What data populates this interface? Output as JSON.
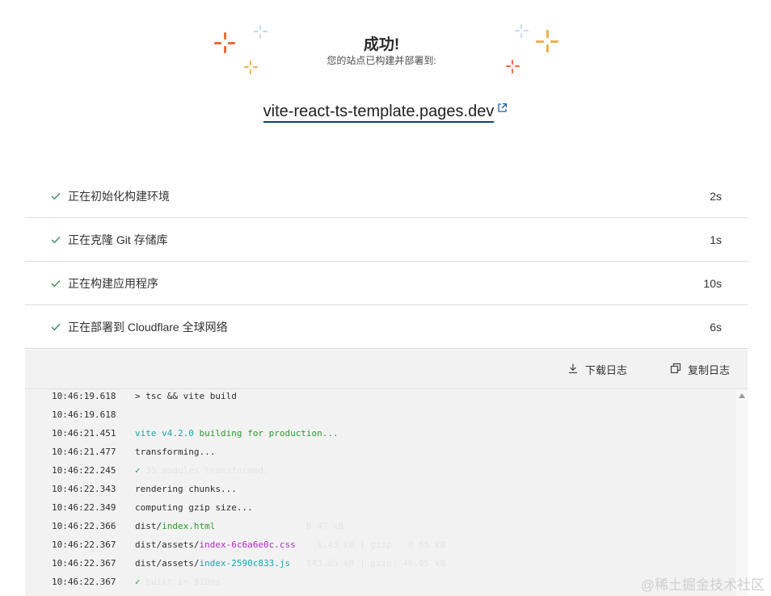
{
  "header": {
    "title": "成功!",
    "subtitle": "您的站点已构建并部署到:",
    "site_url": "vite-react-ts-template.pages.dev",
    "link_icon": "external-link-icon"
  },
  "colors": {
    "spark_orange": "#ee6b3a",
    "spark_blue": "#c5d8ec",
    "spark_yellow": "#f2b04a",
    "check_green": "#2f8a4f",
    "link_underline": "#0a3f7d"
  },
  "steps": [
    {
      "label": "正在初始化构建环境",
      "duration": "2s",
      "icon": "check-icon"
    },
    {
      "label": "正在克隆 Git 存储库",
      "duration": "1s",
      "icon": "check-icon"
    },
    {
      "label": "正在构建应用程序",
      "duration": "10s",
      "icon": "check-icon"
    },
    {
      "label": "正在部署到 Cloudflare 全球网络",
      "duration": "6s",
      "icon": "check-icon"
    }
  ],
  "toolbar": {
    "download_label": "下载日志",
    "download_icon": "download-icon",
    "copy_label": "复制日志",
    "copy_icon": "copy-icon"
  },
  "log": {
    "lines": [
      {
        "ts": "10:46:19.618",
        "parts": [
          {
            "t": "> tsc && vite build",
            "c": ""
          }
        ]
      },
      {
        "ts": "10:46:19.618",
        "parts": []
      },
      {
        "ts": "10:46:21.451",
        "parts": [
          {
            "t": "vite v4.2.0",
            "c": "c-cyan"
          },
          {
            "t": " building for production...",
            "c": "c-green"
          }
        ]
      },
      {
        "ts": "10:46:21.477",
        "parts": [
          {
            "t": "transforming...",
            "c": ""
          }
        ]
      },
      {
        "ts": "10:46:22.245",
        "parts": [
          {
            "t": "✓",
            "c": "c-check"
          },
          {
            "t": " 35 modules transformed.",
            "c": "faded"
          }
        ]
      },
      {
        "ts": "10:46:22.343",
        "parts": [
          {
            "t": "rendering chunks...",
            "c": ""
          }
        ]
      },
      {
        "ts": "10:46:22.349",
        "parts": [
          {
            "t": "computing gzip size...",
            "c": ""
          }
        ]
      },
      {
        "ts": "10:46:22.366",
        "parts": [
          {
            "t": "dist/",
            "c": ""
          },
          {
            "t": "index.html",
            "c": "c-green"
          },
          {
            "t": "                 0.47 kB",
            "c": "faded"
          }
        ]
      },
      {
        "ts": "10:46:22.367",
        "parts": [
          {
            "t": "dist/assets/",
            "c": ""
          },
          {
            "t": "index-6c6a6e0c.css",
            "c": "c-magenta"
          },
          {
            "t": "    1.43 kB | gzip:  0.65 kB",
            "c": "faded"
          }
        ]
      },
      {
        "ts": "10:46:22.367",
        "parts": [
          {
            "t": "dist/assets/",
            "c": ""
          },
          {
            "t": "index-2590c833.js",
            "c": "c-cyan"
          },
          {
            "t": "   143.05 kB | gzip: 46.05 kB",
            "c": "faded"
          }
        ]
      },
      {
        "ts": "10:46:22.367",
        "parts": [
          {
            "t": "✓",
            "c": "c-check"
          },
          {
            "t": " built in 910ms",
            "c": "faded"
          }
        ]
      }
    ]
  },
  "watermark": "@稀土掘金技术社区"
}
